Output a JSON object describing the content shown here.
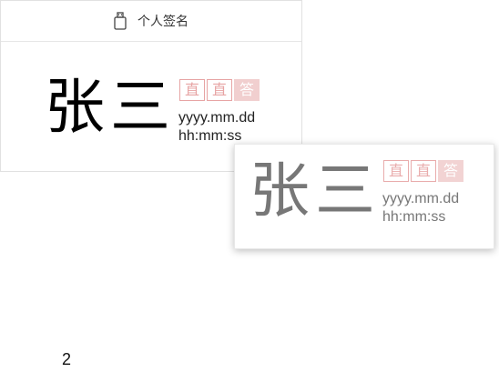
{
  "panel": {
    "title": "个人签名",
    "icon": "usb-drive-icon",
    "signature_name": "张三",
    "stamp_chars": [
      "直",
      "直",
      "答"
    ],
    "date_format": "yyyy.mm.dd",
    "time_format": "hh:mm:ss"
  },
  "preview": {
    "signature_name": "张三",
    "stamp_chars": [
      "直",
      "直",
      "答"
    ],
    "date_format": "yyyy.mm.dd",
    "time_format": "hh:mm:ss"
  },
  "footer": {
    "page_number": "2"
  },
  "colors": {
    "stamp": "#e7a4a4",
    "preview_text": "#777777"
  }
}
